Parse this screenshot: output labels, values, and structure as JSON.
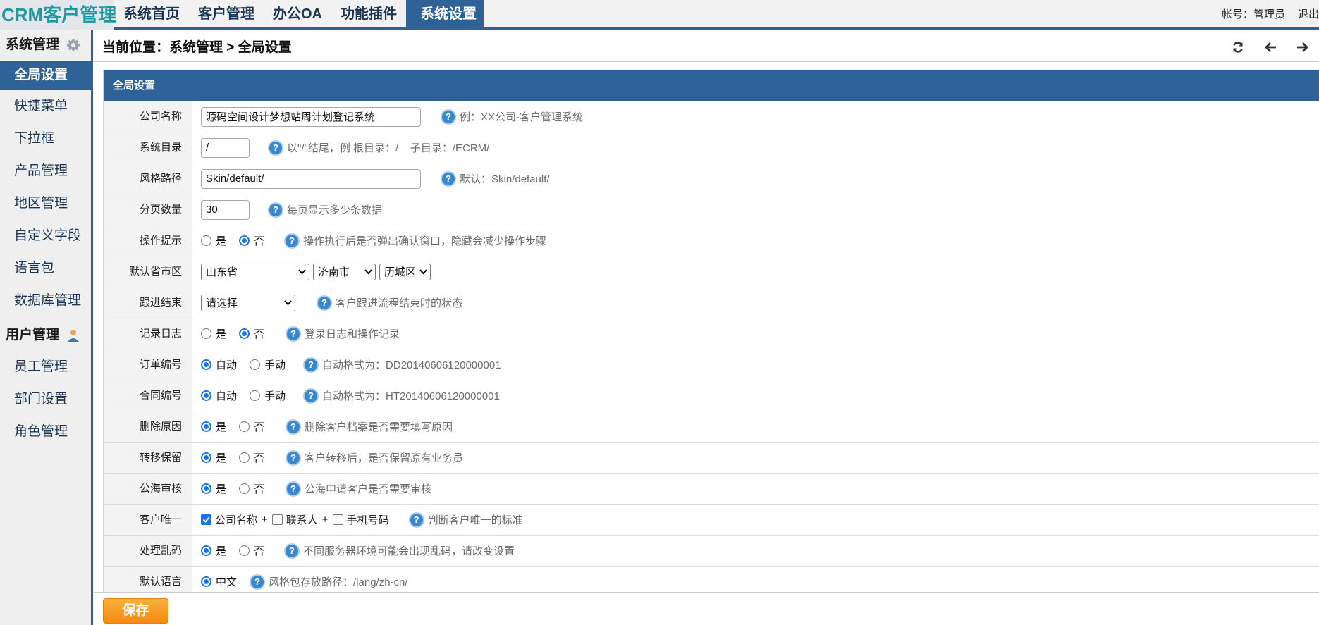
{
  "app": {
    "logo": "CRM客户管理"
  },
  "nav": [
    {
      "label": "系统首页",
      "active": false
    },
    {
      "label": "客户管理",
      "active": false
    },
    {
      "label": "办公OA",
      "active": false
    },
    {
      "label": "功能插件",
      "active": false
    },
    {
      "label": "系统设置",
      "active": true
    }
  ],
  "account": {
    "text": "帐号：管理员",
    "logout": "退出"
  },
  "sidebar": {
    "group1": {
      "title": "系统管理",
      "icon": "gear-icon"
    },
    "items1": [
      {
        "label": "全局设置",
        "active": true
      },
      {
        "label": "快捷菜单"
      },
      {
        "label": "下拉框"
      },
      {
        "label": "产品管理"
      },
      {
        "label": "地区管理"
      },
      {
        "label": "自定义字段"
      },
      {
        "label": "语言包"
      },
      {
        "label": "数据库管理"
      }
    ],
    "group2": {
      "title": "用户管理",
      "icon": "user-icon"
    },
    "items2": [
      {
        "label": "员工管理"
      },
      {
        "label": "部门设置"
      },
      {
        "label": "角色管理"
      }
    ]
  },
  "breadcrumb": {
    "text": "当前位置：系统管理 > 全局设置"
  },
  "panel": {
    "title": "全局设置",
    "rows": {
      "company": {
        "label": "公司名称",
        "value": "源码空间设计梦想站周计划登记系统",
        "hint": "例：XX公司-客户管理系统"
      },
      "sysdir": {
        "label": "系统目录",
        "value": "/",
        "hint": "以\"/\"结尾，例 根目录：/    子目录：/ECRM/"
      },
      "skin": {
        "label": "风格路径",
        "value": "Skin/default/",
        "hint": "默认：Skin/default/"
      },
      "pagesize": {
        "label": "分页数量",
        "value": "30",
        "hint": "每页显示多少条数据"
      },
      "optip": {
        "label": "操作提示",
        "yes": "是",
        "no": "否",
        "hint": "操作执行后是否弹出确认窗口，隐藏会减少操作步骤"
      },
      "region": {
        "label": "默认省市区",
        "province": "山东省",
        "city": "济南市",
        "district": "历城区"
      },
      "followend": {
        "label": "跟进结束",
        "value": "请选择",
        "hint": "客户跟进流程结束时的状态"
      },
      "log": {
        "label": "记录日志",
        "yes": "是",
        "no": "否",
        "hint": "登录日志和操作记录"
      },
      "orderno": {
        "label": "订单编号",
        "auto": "自动",
        "manual": "手动",
        "hint": "自动格式为：DD20140606120000001"
      },
      "contractno": {
        "label": "合同编号",
        "auto": "自动",
        "manual": "手动",
        "hint": "自动格式为：HT20140606120000001"
      },
      "delreason": {
        "label": "删除原因",
        "yes": "是",
        "no": "否",
        "hint": "删除客户档案是否需要填写原因"
      },
      "transfer": {
        "label": "转移保留",
        "yes": "是",
        "no": "否",
        "hint": "客户转移后，是否保留原有业务员"
      },
      "seaaudit": {
        "label": "公海审核",
        "yes": "是",
        "no": "否",
        "hint": "公海申请客户是否需要审核"
      },
      "unique": {
        "label": "客户唯一",
        "opt1": "公司名称",
        "opt2": "联系人",
        "opt3": "手机号码",
        "plus": "+",
        "hint": "判断客户唯一的标准"
      },
      "garbled": {
        "label": "处理乱码",
        "yes": "是",
        "no": "否",
        "hint": "不同服务器环境可能会出现乱码，请改变设置"
      },
      "lang": {
        "label": "默认语言",
        "opt": "中文",
        "hint": "风格包存放路径：/lang/zh-cn/"
      }
    }
  },
  "footer": {
    "save": "保存"
  },
  "colors": {
    "primary": "#2f6296",
    "logo": "#1f9aa0",
    "save": "#f7a024",
    "help": "#3a86cf"
  }
}
